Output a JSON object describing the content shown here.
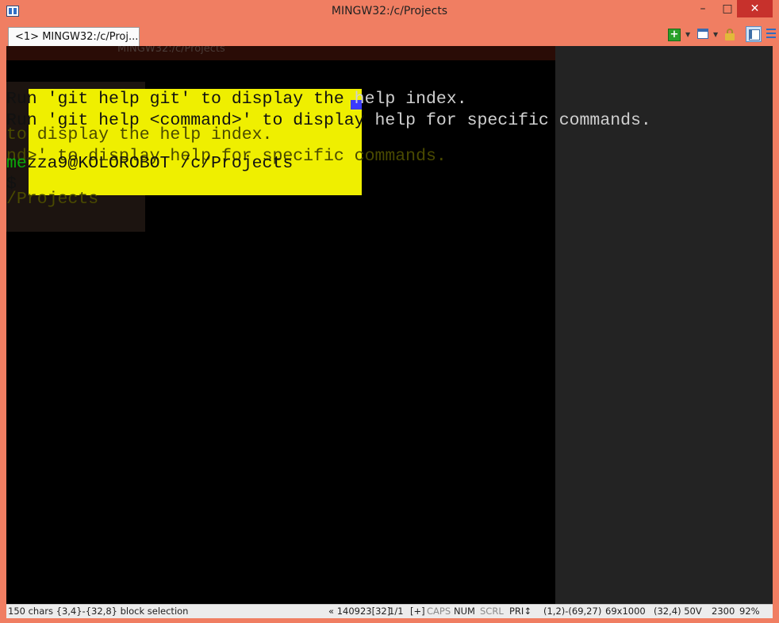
{
  "window": {
    "title": "MINGW32:/c/Projects",
    "minimize": "–",
    "maximize": "□",
    "close": "✕"
  },
  "tabs": [
    {
      "label": "<1> MINGW32:/c/Proj..."
    }
  ],
  "toolbar": {
    "icons": [
      "new-console-icon",
      "window-icon",
      "lock-icon",
      "panel-view-icon",
      "menu-icon"
    ],
    "dropdown_glyph": "▼",
    "new_glyph": "+"
  },
  "ghost": {
    "title": "MINGW32:/c/Projects",
    "lines": [
      "to display the help index.",
      "nd>' to display help for specific commands.",
      "",
      "/Projects"
    ]
  },
  "terminal": {
    "lines": [
      {
        "pre": "Run 'git help git' to display the",
        "post": " help index."
      },
      {
        "pre": "Run 'git help <command>' to display",
        "post": " help for specific commands."
      }
    ],
    "prompt_user": "me",
    "prompt_rest": "zza9@KOLOROBOT /c/Projects",
    "prompt_symbol": "$"
  },
  "statusbar": {
    "selection": "150 chars {3,4}-{32,8} block selection",
    "buffer": "« 140923[32]",
    "pages": "1/1",
    "plus": "[+]",
    "caps": "CAPS",
    "num": "NUM",
    "scrl": "SCRL",
    "pri": "PRI↕",
    "range": "(1,2)-(69,27)",
    "size": "69x1000",
    "cursor": "(32,4) 50V",
    "pid": "2300",
    "zoom": "92%"
  },
  "colors": {
    "frame": "#f07e62",
    "console_bg": "#000000",
    "selection": "#efef00",
    "prompt_user": "#0aa90a",
    "close_button": "#c7312c"
  }
}
